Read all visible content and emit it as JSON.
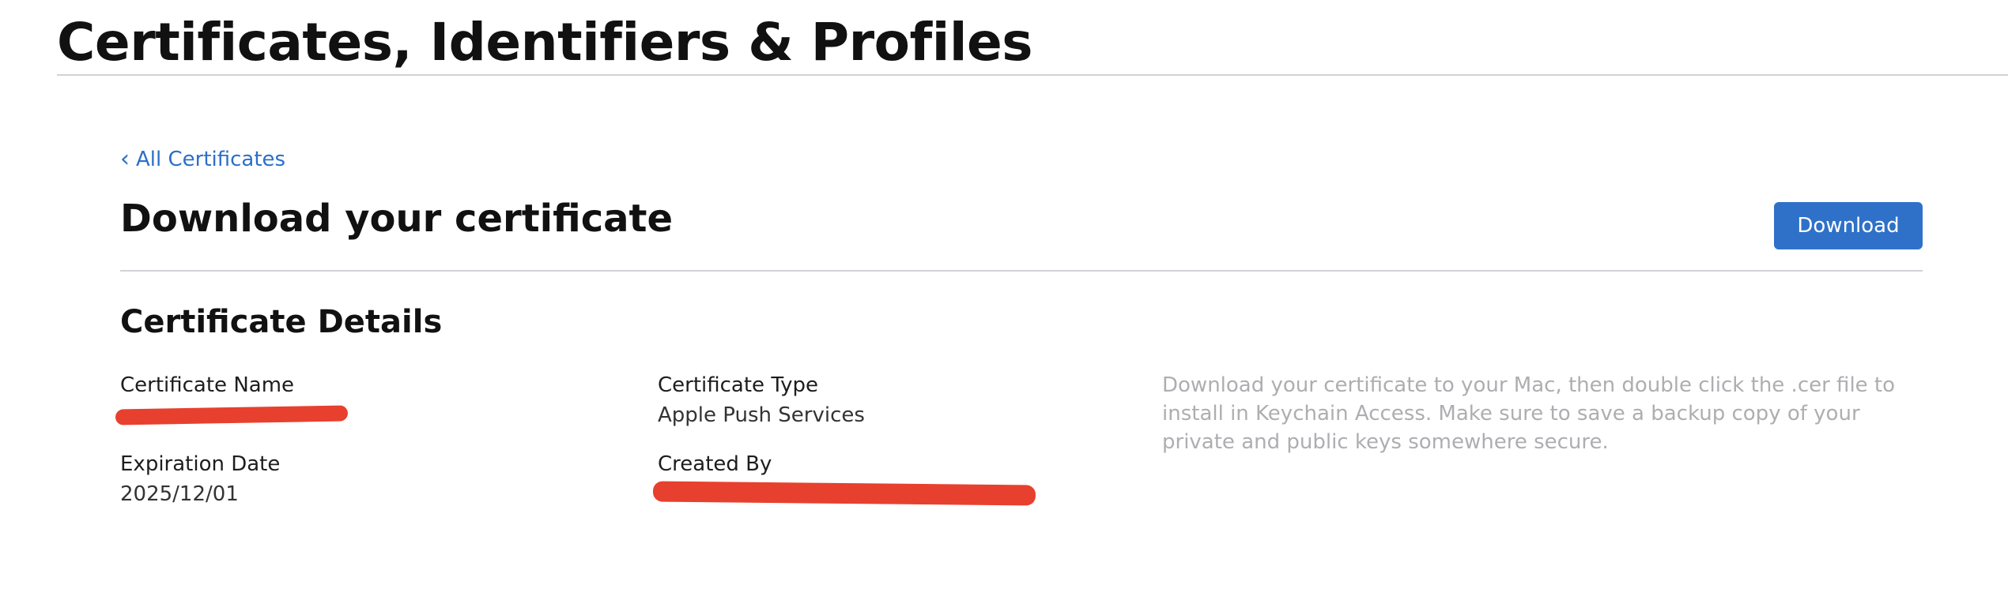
{
  "header": {
    "title": "Certificates, Identifiers & Profiles"
  },
  "nav": {
    "back_label": "All Certificates"
  },
  "main": {
    "title": "Download your certificate",
    "download_label": "Download",
    "details_title": "Certificate Details",
    "fields": {
      "certificate_name_label": "Certificate Name",
      "certificate_type_label": "Certificate Type",
      "certificate_type_value": "Apple Push Services",
      "expiration_date_label": "Expiration Date",
      "expiration_date_value": "2025/12/01",
      "created_by_label": "Created By"
    },
    "help_text": "Download your certificate to your Mac, then double click the .cer file to install in Keychain Access. Make sure to save a backup copy of your private and public keys somewhere secure."
  },
  "colors": {
    "accent": "#2f71c8",
    "link": "#2b6fc8",
    "redaction": "#e8402e",
    "muted_text": "#aeaeb2",
    "rule": "#d2d2d7"
  },
  "icons": {
    "back": "chevron-left-icon"
  }
}
